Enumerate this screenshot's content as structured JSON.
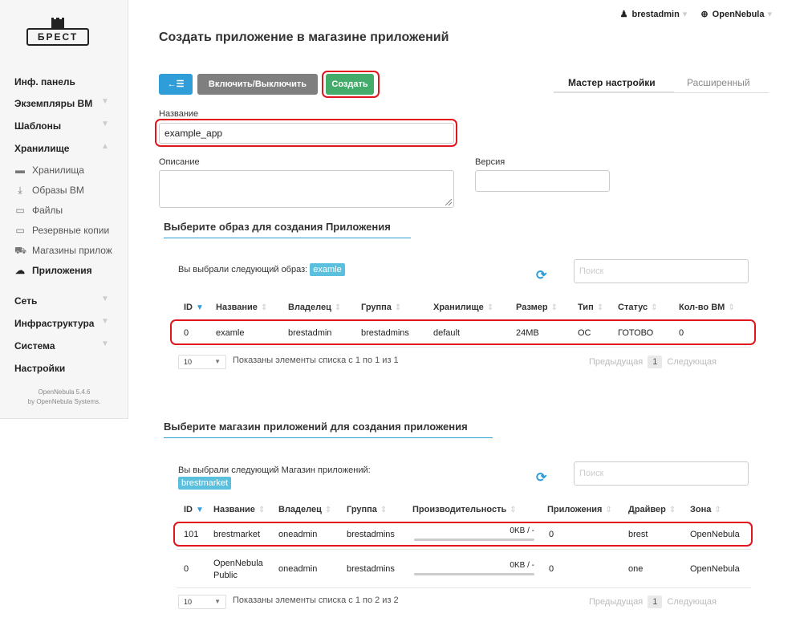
{
  "logo": {
    "text": "БРЕСТ"
  },
  "sidebar": {
    "items": [
      {
        "label": "Инф. панель"
      },
      {
        "label": "Экземпляры ВМ"
      },
      {
        "label": "Шаблоны"
      },
      {
        "label": "Хранилище"
      }
    ],
    "storage_sub": [
      {
        "label": "Хранилища",
        "icon": "folder-icon"
      },
      {
        "label": "Образы ВМ",
        "icon": "download-icon"
      },
      {
        "label": "Файлы",
        "icon": "archive-icon"
      },
      {
        "label": "Резервные копии",
        "icon": "archive-icon"
      },
      {
        "label": "Магазины прилож",
        "icon": "cart-icon"
      },
      {
        "label": "Приложения",
        "icon": "cloud-icon"
      }
    ],
    "items_bottom": [
      {
        "label": "Сеть"
      },
      {
        "label": "Инфраструктура"
      },
      {
        "label": "Система"
      },
      {
        "label": "Настройки"
      }
    ],
    "version_line1": "OpenNebula 5.4.6",
    "version_line2": "by OpenNebula Systems."
  },
  "topbar": {
    "user": "brestadmin",
    "zone": "OpenNebula"
  },
  "page_title": "Создать приложение в магазине приложений",
  "toolbar": {
    "back_icon": "←☰",
    "toggle_label": "Включить/Выключить",
    "create_label": "Создать"
  },
  "tabs": {
    "wizard": "Мастер настройки",
    "advanced": "Расширенный"
  },
  "form": {
    "name_label": "Название",
    "name_value": "example_app",
    "description_label": "Описание",
    "version_label": "Версия"
  },
  "image_section": {
    "title": "Выберите образ для создания Приложения",
    "selected_text": "Вы выбрали следующий образ:",
    "selected_tag": "examle",
    "search_placeholder": "Поиск",
    "columns": [
      "ID",
      "Название",
      "Владелец",
      "Группа",
      "Хранилище",
      "Размер",
      "Тип",
      "Статус",
      "Кол-во ВМ"
    ],
    "rows": [
      {
        "id": "0",
        "name": "examle",
        "owner": "brestadmin",
        "group": "brestadmins",
        "datastore": "default",
        "size": "24MB",
        "type": "OC",
        "status": "ГОТОВО",
        "vms": "0"
      }
    ],
    "page_size": "10",
    "info": "Показаны элементы списка с 1 по 1 из 1",
    "prev": "Предыдущая",
    "page": "1",
    "next": "Следующая"
  },
  "market_section": {
    "title": "Выберите магазин приложений для создания приложения",
    "selected_text": "Вы выбрали следующий Магазин приложений:",
    "selected_tag": "brestmarket",
    "search_placeholder": "Поиск",
    "columns": [
      "ID",
      "Название",
      "Владелец",
      "Группа",
      "Производительность",
      "Приложения",
      "Драйвер",
      "Зона"
    ],
    "rows": [
      {
        "id": "101",
        "name": "brestmarket",
        "owner": "oneadmin",
        "group": "brestadmins",
        "perf": "0KB / -",
        "apps": "0",
        "driver": "brest",
        "zone": "OpenNebula"
      },
      {
        "id": "0",
        "name": "OpenNebula Public",
        "owner": "oneadmin",
        "group": "brestadmins",
        "perf": "0KB / -",
        "apps": "0",
        "driver": "one",
        "zone": "OpenNebula"
      }
    ],
    "page_size": "10",
    "info": "Показаны элементы списка с 1 по 2 из 2",
    "prev": "Предыдущая",
    "page": "1",
    "next": "Следующая"
  },
  "colors": {
    "primary": "#2f9ed8",
    "success": "#43ac6a",
    "secondary": "#7f7f7f",
    "highlight": "#e0151d",
    "tag": "#5bc0de"
  }
}
